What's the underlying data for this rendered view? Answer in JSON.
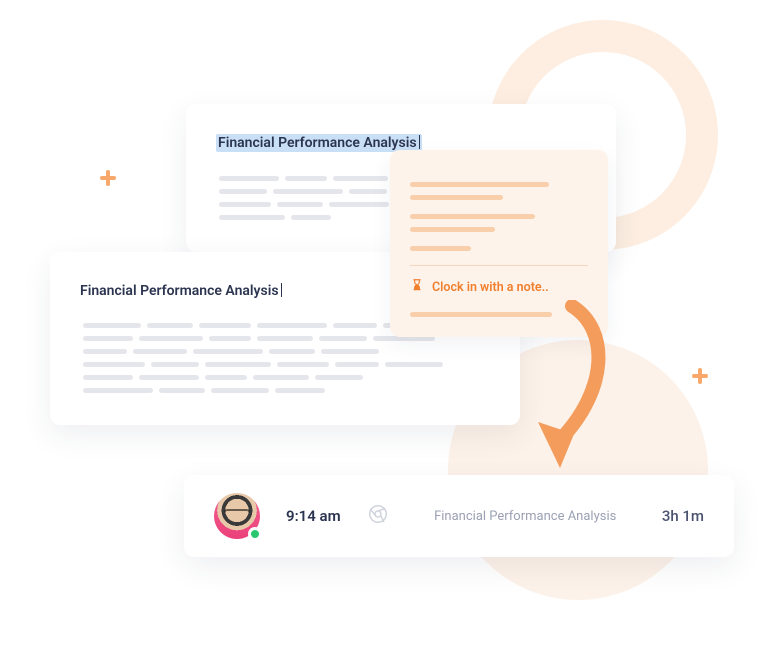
{
  "card_back": {
    "title": "Financial Performance Analysis"
  },
  "card_front": {
    "title": "Financial Performance Analysis"
  },
  "popover": {
    "action_label": "Clock in with a note.."
  },
  "entry": {
    "time": "9:14 am",
    "title": "Financial Performance Analysis",
    "duration": "3h 1m"
  },
  "colors": {
    "accent": "#f07f2e"
  }
}
